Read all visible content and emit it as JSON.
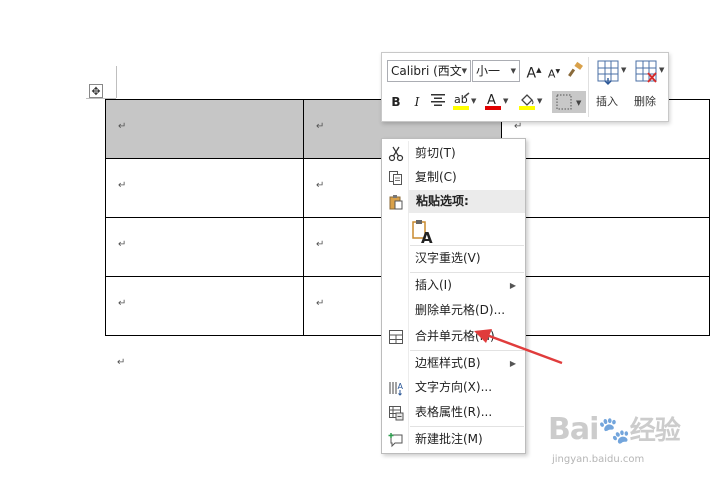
{
  "document": {
    "paragraph_mark": "↵",
    "table": {
      "rows": [
        [
          {
            "mark": "↵",
            "selected": true
          },
          {
            "mark": "↵",
            "selected": true
          },
          {
            "mark": "↵",
            "selected": false
          }
        ],
        [
          {
            "mark": "↵",
            "selected": false
          },
          {
            "mark": "↵",
            "selected": false
          },
          {
            "mark": "",
            "selected": false
          }
        ],
        [
          {
            "mark": "↵",
            "selected": false
          },
          {
            "mark": "↵",
            "selected": false
          },
          {
            "mark": "",
            "selected": false
          }
        ],
        [
          {
            "mark": "↵",
            "selected": false
          },
          {
            "mark": "↵",
            "selected": false
          },
          {
            "mark": "",
            "selected": false
          }
        ]
      ]
    }
  },
  "mini_toolbar": {
    "font_name": "Calibri (西文",
    "font_size": "小一",
    "bold": "B",
    "italic": "I",
    "font_color_letter": "A",
    "insert_label": "插入",
    "delete_label": "删除"
  },
  "context_menu": {
    "items": [
      {
        "label": "剪切(T)",
        "icon": "scissors-icon"
      },
      {
        "label": "复制(C)",
        "icon": "copy-icon"
      },
      {
        "label": "粘贴选项:",
        "icon": "paste-icon"
      },
      {
        "label": "汉字重选(V)",
        "icon": ""
      },
      {
        "label": "插入(I)",
        "icon": "",
        "submenu": true
      },
      {
        "label": "删除单元格(D)...",
        "icon": ""
      },
      {
        "label": "合并单元格(M)",
        "icon": "merge-cells-icon"
      },
      {
        "label": "边框样式(B)",
        "icon": "",
        "submenu": true
      },
      {
        "label": "文字方向(X)...",
        "icon": "text-direction-icon"
      },
      {
        "label": "表格属性(R)...",
        "icon": "table-properties-icon"
      },
      {
        "label": "新建批注(M)",
        "icon": "new-comment-icon"
      }
    ],
    "paste_option_letter": "A"
  },
  "watermark": {
    "logo": "Bai",
    "url": "jingyan.baidu.com"
  },
  "colors": {
    "selection": "#c6c6c6",
    "arrow": "#e03c3c",
    "highlight": "#ffff00",
    "font_red": "#e00000"
  }
}
